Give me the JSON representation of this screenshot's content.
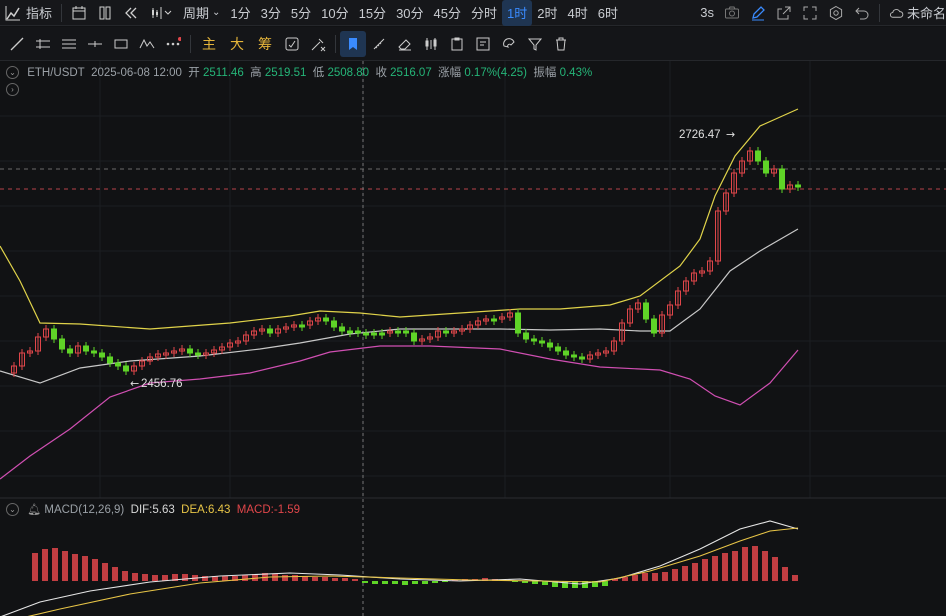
{
  "topbar": {
    "indicators_label": "指标",
    "period_label": "周期",
    "intervals": [
      "1分",
      "3分",
      "5分",
      "10分",
      "15分",
      "30分",
      "45分",
      "分时",
      "1时",
      "2时",
      "4时",
      "6时"
    ],
    "active_interval": "1时",
    "countdown": "3s",
    "layout_name": "未命名"
  },
  "toolbar": {
    "main_label": "主",
    "large_label": "大",
    "chips_label": "筹"
  },
  "info": {
    "symbol": "ETH/USDT",
    "datetime": "2025-06-08 12:00",
    "open_label": "开",
    "open": "2511.46",
    "high_label": "高",
    "high": "2519.51",
    "low_label": "低",
    "low": "2508.80",
    "close_label": "收",
    "close": "2516.07",
    "change_label": "涨幅",
    "change": "0.17%(4.25)",
    "amp_label": "振幅",
    "amp": "0.43%"
  },
  "annotations": {
    "max_price": "2726.47",
    "min_price": "2456.76"
  },
  "macd": {
    "name": "MACD(12,26,9)",
    "dif_label": "DIF:",
    "dif": "5.63",
    "dea_label": "DEA:",
    "dea": "6.43",
    "macd_label": "MACD:",
    "macd": "-1.59"
  },
  "colors": {
    "up": "#e0464a",
    "down": "#5fd427",
    "mid": "#c8c8c8",
    "upper": "#e0d34a",
    "lower": "#d04fb2",
    "dif": "#e6e6e6",
    "dea": "#e8c547",
    "accent": "#3a8bff"
  }
}
